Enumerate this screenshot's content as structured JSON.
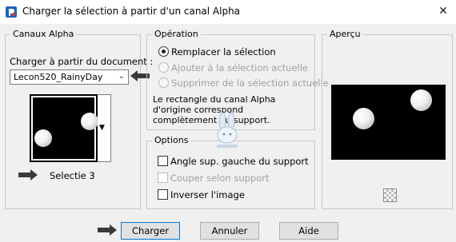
{
  "window": {
    "title": "Charger la sélection à partir d'un canal Alpha",
    "close_glyph": "✕",
    "app_icon": "psp-app-icon"
  },
  "canaux": {
    "legend": "Canaux Alpha",
    "load_from_label": "Charger à partir du document :",
    "document_value": "Lecon520_RainyDay",
    "channel_caption": "Selectie 3"
  },
  "operation": {
    "legend": "Opération",
    "options": [
      {
        "label": "Remplacer la sélection",
        "selected": true,
        "enabled": true
      },
      {
        "label": "Ajouter à la sélection actuelle",
        "selected": false,
        "enabled": false
      },
      {
        "label": "Supprimer de la sélection actuelle",
        "selected": false,
        "enabled": false
      }
    ],
    "description": "Le rectangle du canal Alpha\nd'origine correspond\ncomplètement au support."
  },
  "options": {
    "legend": "Options",
    "items": [
      {
        "label": "Angle sup. gauche du support",
        "checked": false,
        "enabled": true
      },
      {
        "label": "Couper selon support",
        "checked": false,
        "enabled": false
      },
      {
        "label": "Inverser l'image",
        "checked": false,
        "enabled": true
      }
    ]
  },
  "apercu": {
    "legend": "Aperçu"
  },
  "buttons": {
    "load": "Charger",
    "cancel": "Annuler",
    "help": "Aide"
  },
  "colors": {
    "dialog_bg": "#f0f0f0",
    "titlebar_bg": "#ffffff",
    "focus_border": "#0078d7",
    "pointer_arrow": "#3a3a3a"
  }
}
